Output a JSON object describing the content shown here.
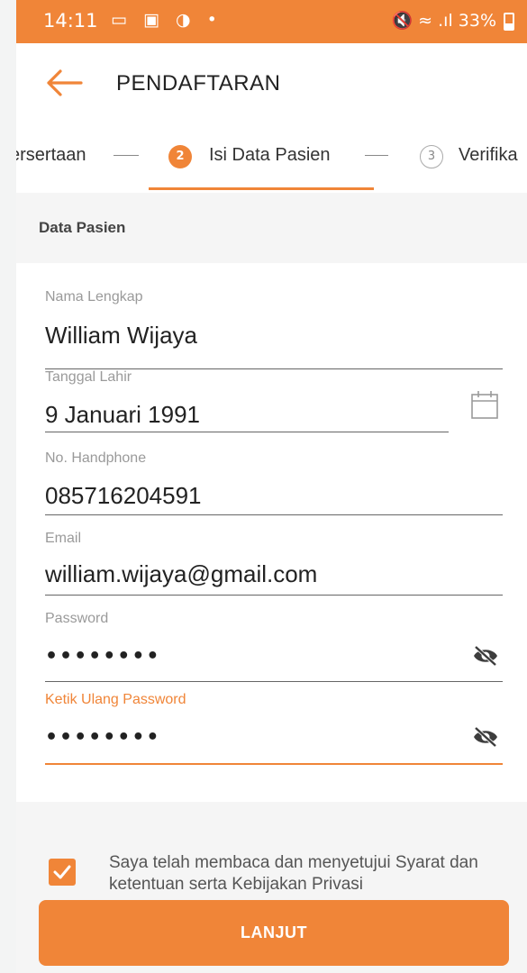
{
  "status_bar": {
    "time": "14:11",
    "left_icons": "▭ ▣ ◑ •",
    "right_text": "🔇 ≈ .ıl 33%",
    "battery": "33%"
  },
  "app_bar": {
    "title": "PENDAFTARAN",
    "back_icon": "arrow-left-icon"
  },
  "stepper": {
    "steps": [
      {
        "number": "",
        "label": "Kepesertaan",
        "visible_label": "ersertaan",
        "state": "done"
      },
      {
        "number": "2",
        "label": "Isi Data Pasien",
        "state": "active"
      },
      {
        "number": "3",
        "label": "Verifika",
        "state": "pending"
      }
    ]
  },
  "section": {
    "title": "Data Pasien"
  },
  "form": {
    "nama": {
      "label": "Nama Lengkap",
      "value": "William Wijaya"
    },
    "tanggal": {
      "label": "Tanggal Lahir",
      "value": "9 Januari 1991",
      "icon": "calendar-icon"
    },
    "phone": {
      "label": "No. Handphone",
      "value": "085716204591"
    },
    "email": {
      "label": "Email",
      "value": "william.wijaya@gmail.com"
    },
    "password": {
      "label": "Password",
      "value": "••••••••",
      "icon": "eye-off-icon"
    },
    "password2": {
      "label": "Ketik Ulang Password",
      "value": "••••••••",
      "icon": "eye-off-icon"
    }
  },
  "agreement": {
    "checked": true,
    "text": "Saya telah membaca dan menyetujui Syarat dan  ketentuan serta Kebijakan Privasi"
  },
  "button": {
    "label": "LANJUT"
  },
  "colors": {
    "accent": "#f08538",
    "background": "#f5f5f5"
  }
}
